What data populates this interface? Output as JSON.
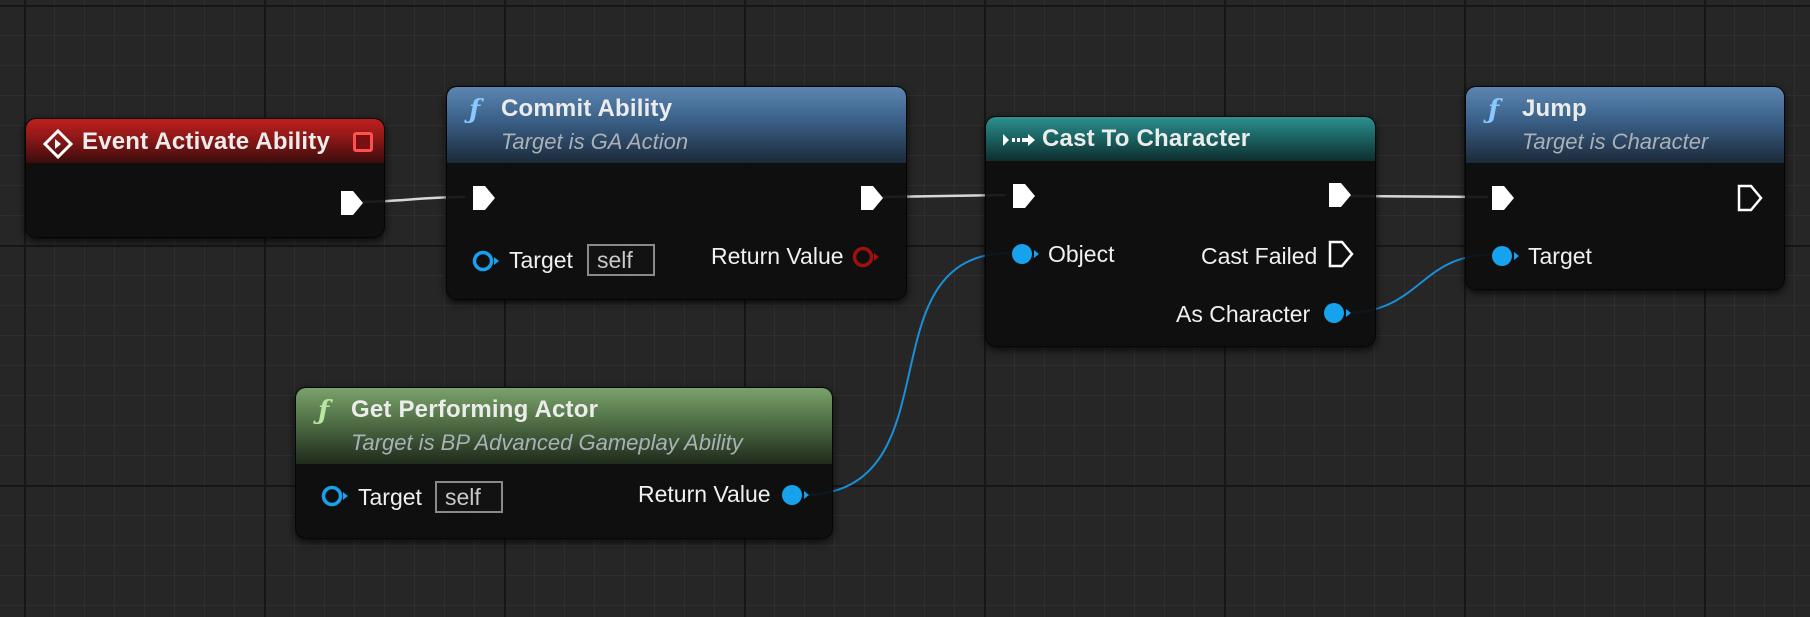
{
  "nodes": {
    "event_activate": {
      "title": "Event Activate Ability"
    },
    "commit_ability": {
      "title": "Commit Ability",
      "subtitle": "Target is GA Action",
      "target_label": "Target",
      "target_value": "self",
      "return_label": "Return Value"
    },
    "cast_to_character": {
      "title": "Cast To Character",
      "object_label": "Object",
      "cast_failed_label": "Cast Failed",
      "as_character_label": "As Character"
    },
    "jump": {
      "title": "Jump",
      "subtitle": "Target is Character",
      "target_label": "Target"
    },
    "get_performing_actor": {
      "title": "Get Performing Actor",
      "subtitle": "Target is BP Advanced Gameplay Ability",
      "target_label": "Target",
      "target_value": "self",
      "return_label": "Return Value"
    }
  },
  "icons": {
    "function": "ƒ",
    "event": "event-diamond-icon",
    "cast": "cast-arrows-icon",
    "delegate": "red-square-delegate-icon"
  },
  "colors": {
    "background": "#262626",
    "exec_wire": "#d8d8d8",
    "object_wire": "#1a8fd8",
    "object_pin": "#16a2ec",
    "bool_pin": "#a10f0f",
    "event_header": "#8e1a1a",
    "function_header": "#3f6d99",
    "pure_header": "#6c8f5e",
    "cast_header": "#1d6b6b"
  }
}
